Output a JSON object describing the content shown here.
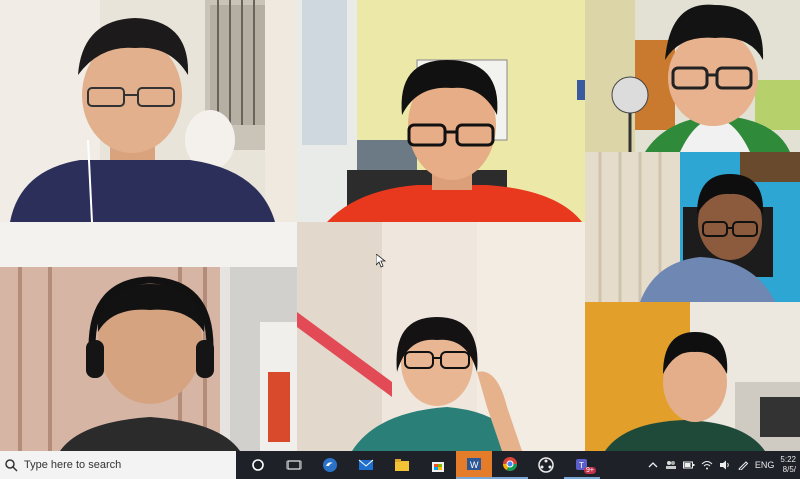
{
  "meeting": {
    "participants": [
      {
        "id": "p1"
      },
      {
        "id": "p2"
      },
      {
        "id": "p3"
      },
      {
        "id": "p4"
      },
      {
        "id": "p5"
      },
      {
        "id": "p6"
      },
      {
        "id": "p7"
      }
    ]
  },
  "taskbar": {
    "search_placeholder": "Type here to search",
    "apps": [
      "task-view",
      "edge",
      "mail",
      "file-explorer",
      "store",
      "word",
      "chrome",
      "media-app",
      "teams"
    ],
    "teams_badge": "9+",
    "language": "ENG",
    "time": "5:22",
    "date": "8/5/"
  },
  "colors": {
    "taskbar_bg": "#1f2128",
    "search_bg": "#f3f3f3",
    "word_accent": "#e57c2a"
  }
}
